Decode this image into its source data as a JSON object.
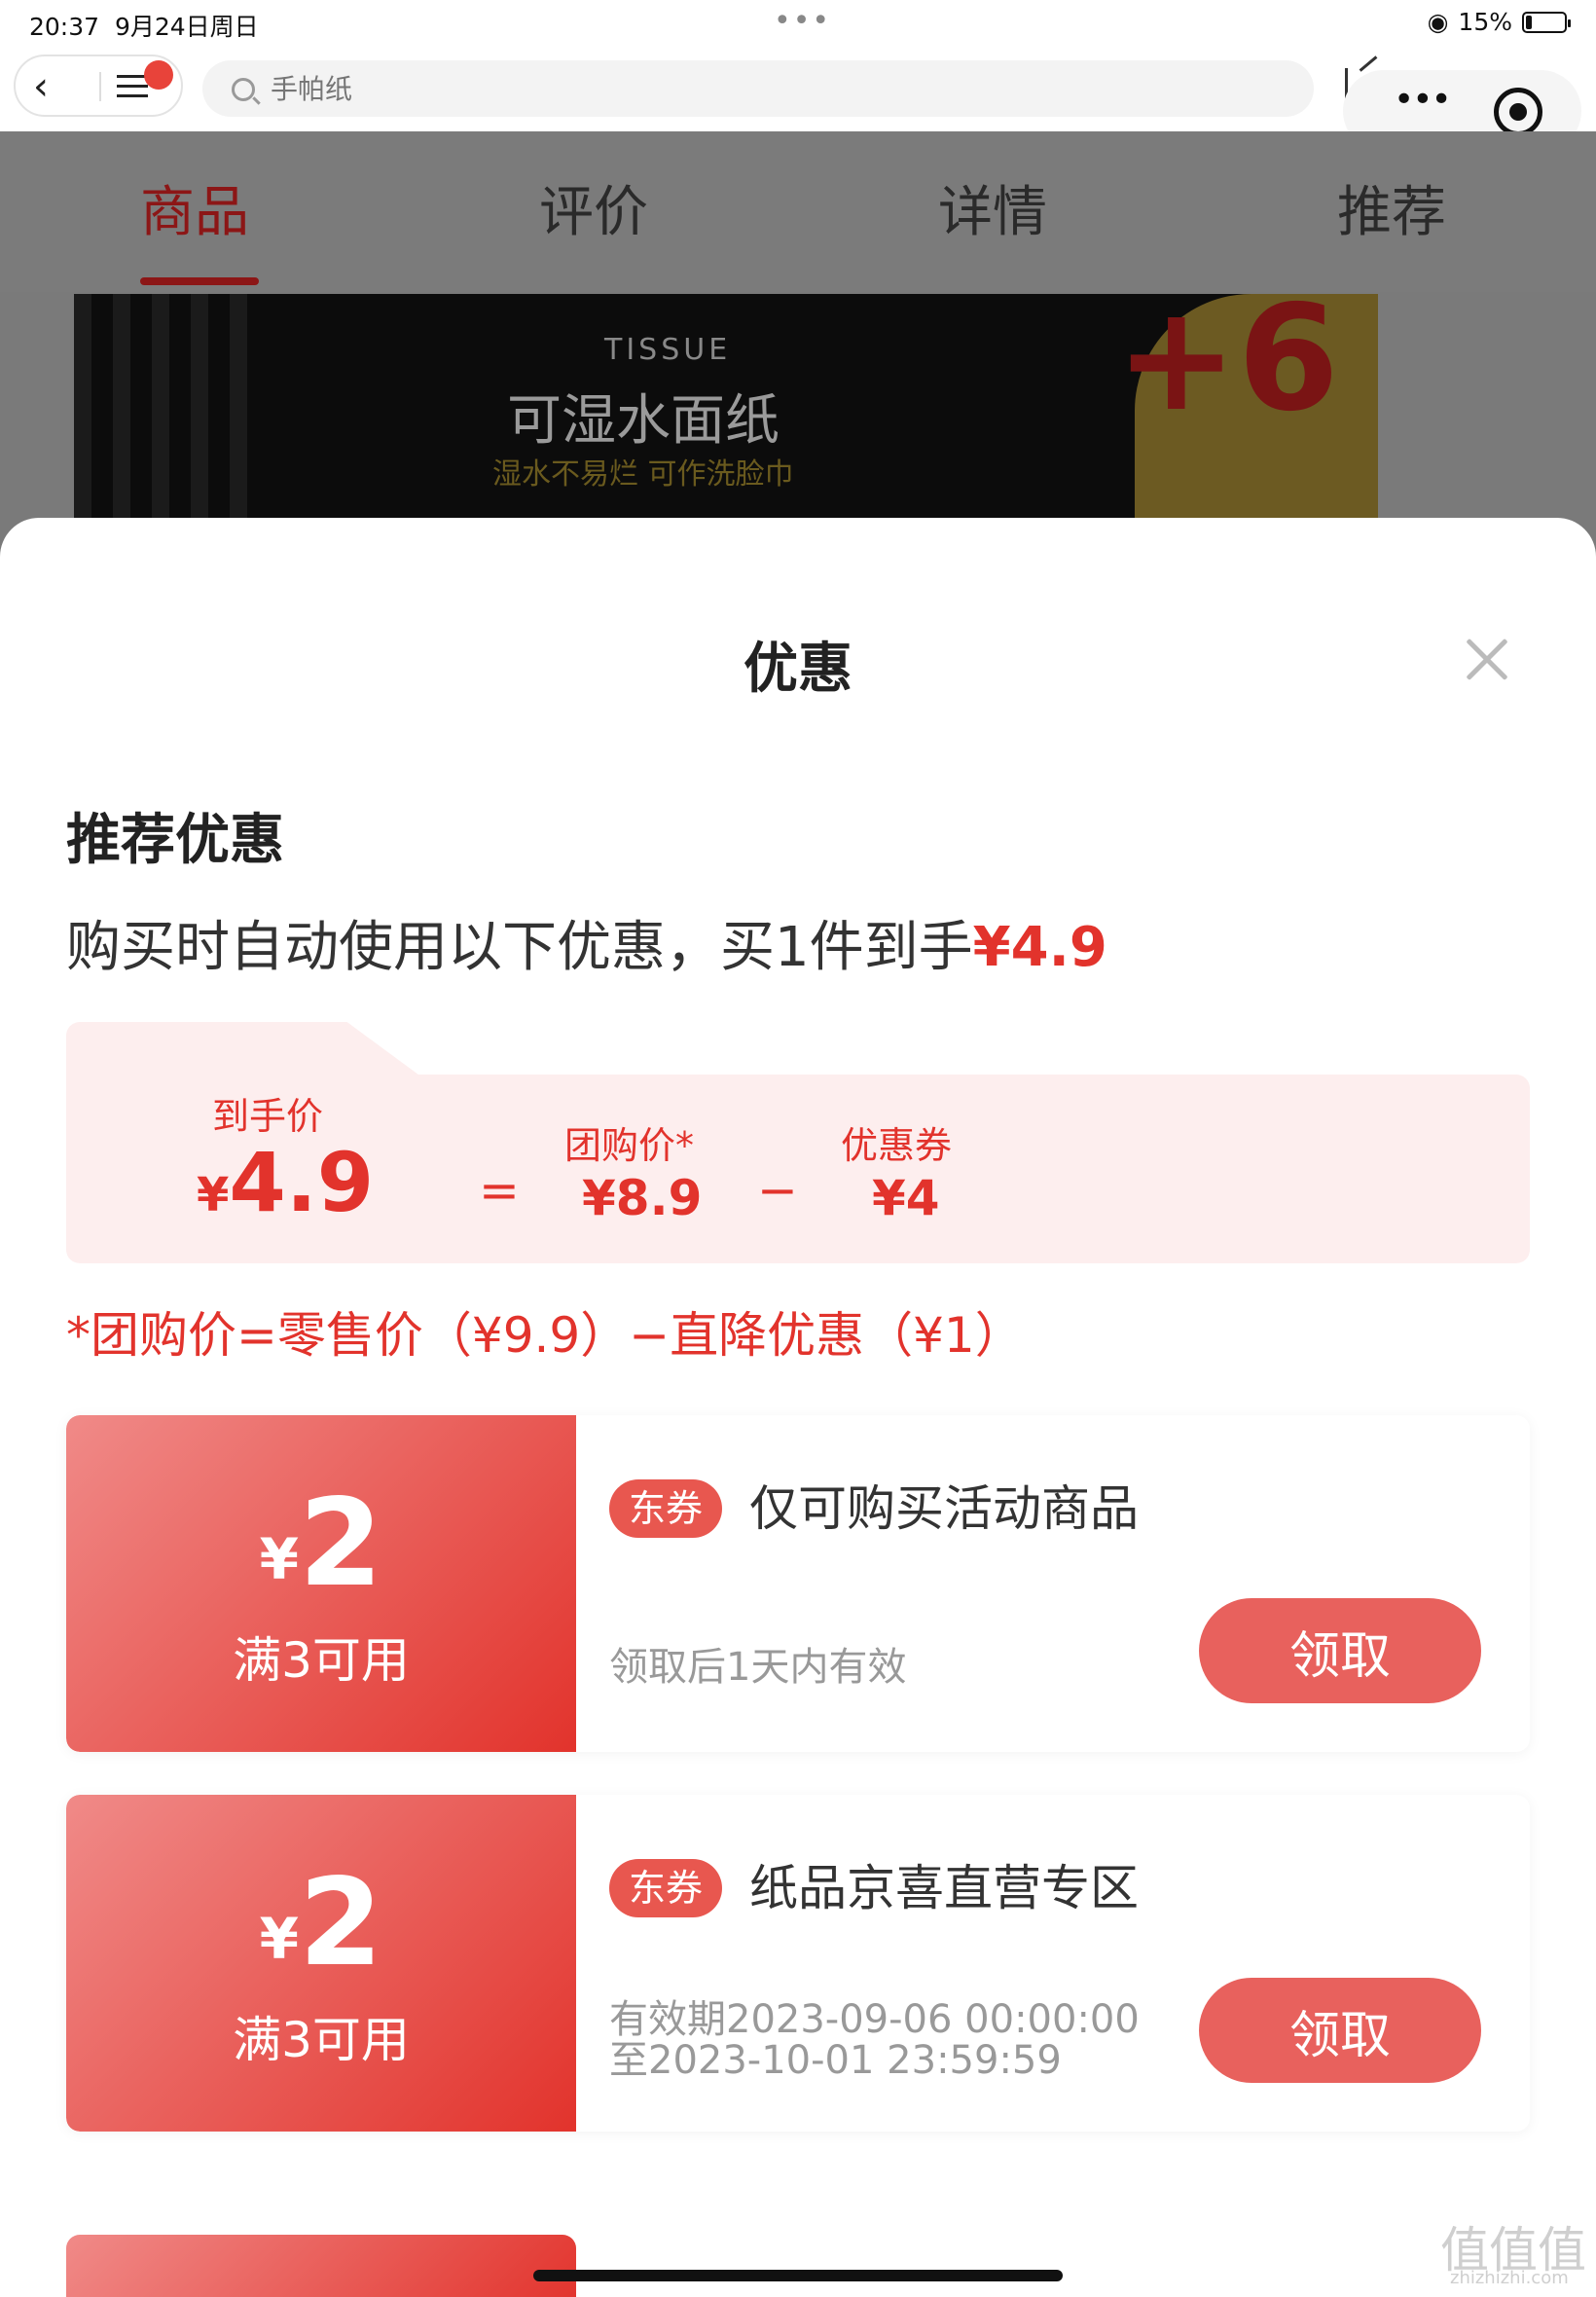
{
  "status_bar": {
    "time": "20:37",
    "date": "9月24日周日",
    "dots": "•••",
    "battery_percent": "15%"
  },
  "nav": {
    "search_placeholder": "手帕纸",
    "more_glyph": "•••"
  },
  "tabs": [
    {
      "label": "商品",
      "active": true
    },
    {
      "label": "评价"
    },
    {
      "label": "详情"
    },
    {
      "label": "推荐"
    }
  ],
  "product_banner": {
    "tissue": "TISSUE",
    "title": "可湿水面纸",
    "subtitle": "湿水不易烂 可作洗脸巾",
    "badge": "+6"
  },
  "sheet": {
    "title": "优惠",
    "recommend_title": "推荐优惠",
    "recommend_desc_prefix": "购买时自动使用以下优惠，买1件到手",
    "recommend_desc_price": "¥4.9",
    "calc": {
      "final_label": "到手价",
      "final_currency": "¥",
      "final_value": "4.9",
      "equals": "=",
      "group_label": "团购价*",
      "group_value": "¥8.9",
      "minus": "−",
      "coupon_label": "优惠券",
      "coupon_value": "¥4"
    },
    "note": "*团购价=零售价（¥9.9）−直降优惠（¥1）"
  },
  "coupons": [
    {
      "currency": "¥",
      "amount": "2",
      "condition": "满3可用",
      "tag": "东券",
      "title": "仅可购买活动商品",
      "validity_line1": "领取后1天内有效",
      "validity_line2": "",
      "button": "领取"
    },
    {
      "currency": "¥",
      "amount": "2",
      "condition": "满3可用",
      "tag": "东券",
      "title": "纸品京喜直营专区",
      "validity_line1": "有效期2023-09-06 00:00:00",
      "validity_line2": "至2023-10-01 23:59:59",
      "button": "领取"
    }
  ],
  "watermark": {
    "text": "值值值",
    "sub": "zhizhizhi.com"
  },
  "colors": {
    "accent_red": "#e2332c",
    "button_red": "#e8615d",
    "calc_bg": "#fdeeee"
  }
}
